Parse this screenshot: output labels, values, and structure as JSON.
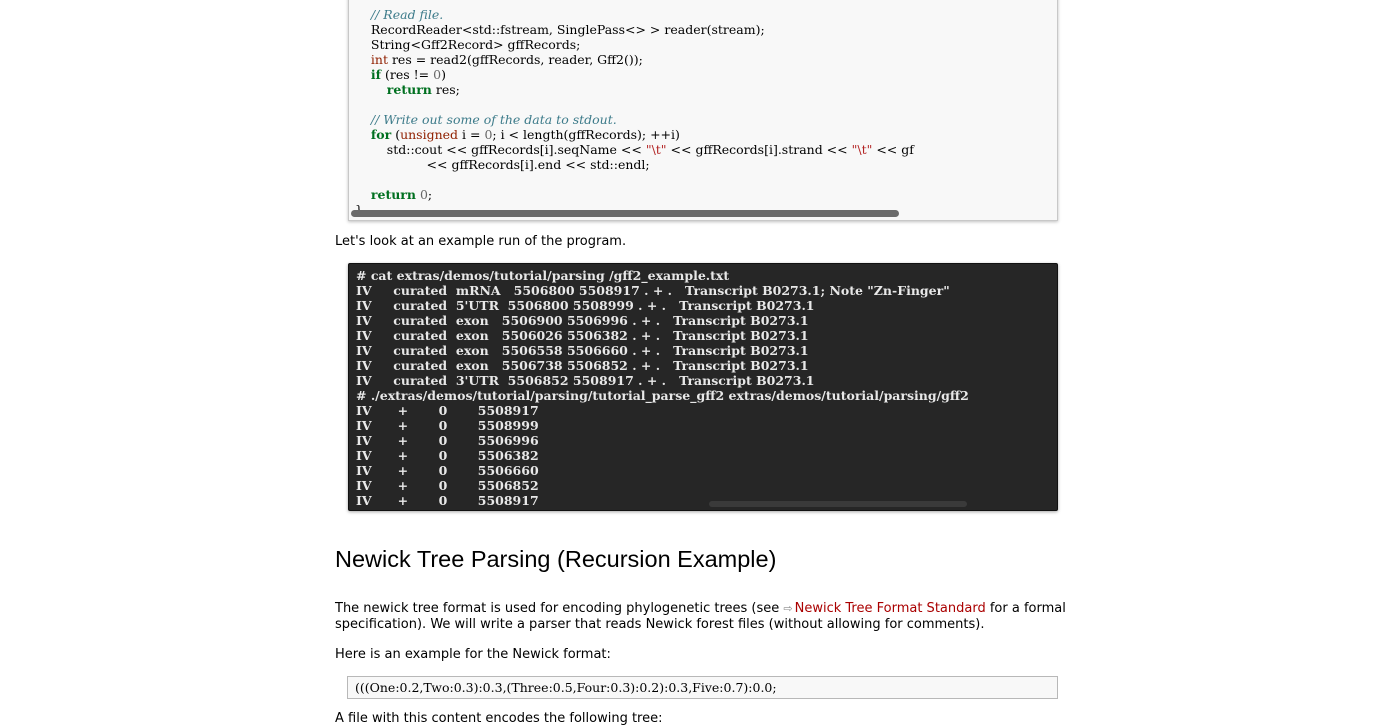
{
  "top_code": {
    "lines": [
      "    // Read file.",
      "    RecordReader<std::fstream, SinglePass<> > reader(stream);",
      "    String<Gff2Record> gffRecords;",
      "    int res = read2(gffRecords, reader, Gff2());",
      "    if (res != 0)",
      "        return res;",
      "",
      "    // Write out some of the data to stdout.",
      "    for (unsigned i = 0; i < length(gffRecords); ++i)",
      "        std::cout << gffRecords[i].seqName << \"\\t\" << gffRecords[i].strand << \"\\t\" << gf",
      "                  << gffRecords[i].end << std::endl;",
      "",
      "    return 0;",
      "}"
    ]
  },
  "intro_run": "Let's look at an example run of the program.",
  "terminal": {
    "lines": [
      "# cat extras/demos/tutorial/parsing /gff2_example.txt",
      "IV     curated  mRNA   5506800 5508917 . + .   Transcript B0273.1; Note \"Zn-Finger\"",
      "IV     curated  5'UTR  5506800 5508999 . + .   Transcript B0273.1",
      "IV     curated  exon   5506900 5506996 . + .   Transcript B0273.1",
      "IV     curated  exon   5506026 5506382 . + .   Transcript B0273.1",
      "IV     curated  exon   5506558 5506660 . + .   Transcript B0273.1",
      "IV     curated  exon   5506738 5506852 . + .   Transcript B0273.1",
      "IV     curated  3'UTR  5506852 5508917 . + .   Transcript B0273.1",
      "# ./extras/demos/tutorial/parsing/tutorial_parse_gff2 extras/demos/tutorial/parsing/gff2",
      "IV      +       0       5508917",
      "IV      +       0       5508999",
      "IV      +       0       5506996",
      "IV      +       0       5506382",
      "IV      +       0       5506660",
      "IV      +       0       5506852",
      "IV      +       0       5508917"
    ]
  },
  "section": {
    "heading": "Newick Tree Parsing (Recursion Example)",
    "para1_before": "The newick tree format is used for encoding phylogenetic trees (see ",
    "link_icon": "external-link-icon",
    "link_text": "Newick Tree Format Standard",
    "para1_after": " for a formal specification). We will write a parser that reads Newick forest files (without allowing for comments).",
    "para2": "Here is an example for the Newick format:",
    "newick_example": "(((One:0.2,Two:0.3):0.3,(Three:0.5,Four:0.3):0.2):0.3,Five:0.7):0.0;",
    "para3": "A file with this content encodes the following tree:"
  },
  "colors": {
    "link": "#aa0000",
    "terminal_bg": "#262626",
    "code_bg": "#f8f8f8",
    "keyword": "#007020",
    "comment": "#3d7b8a",
    "string": "#b22222"
  }
}
